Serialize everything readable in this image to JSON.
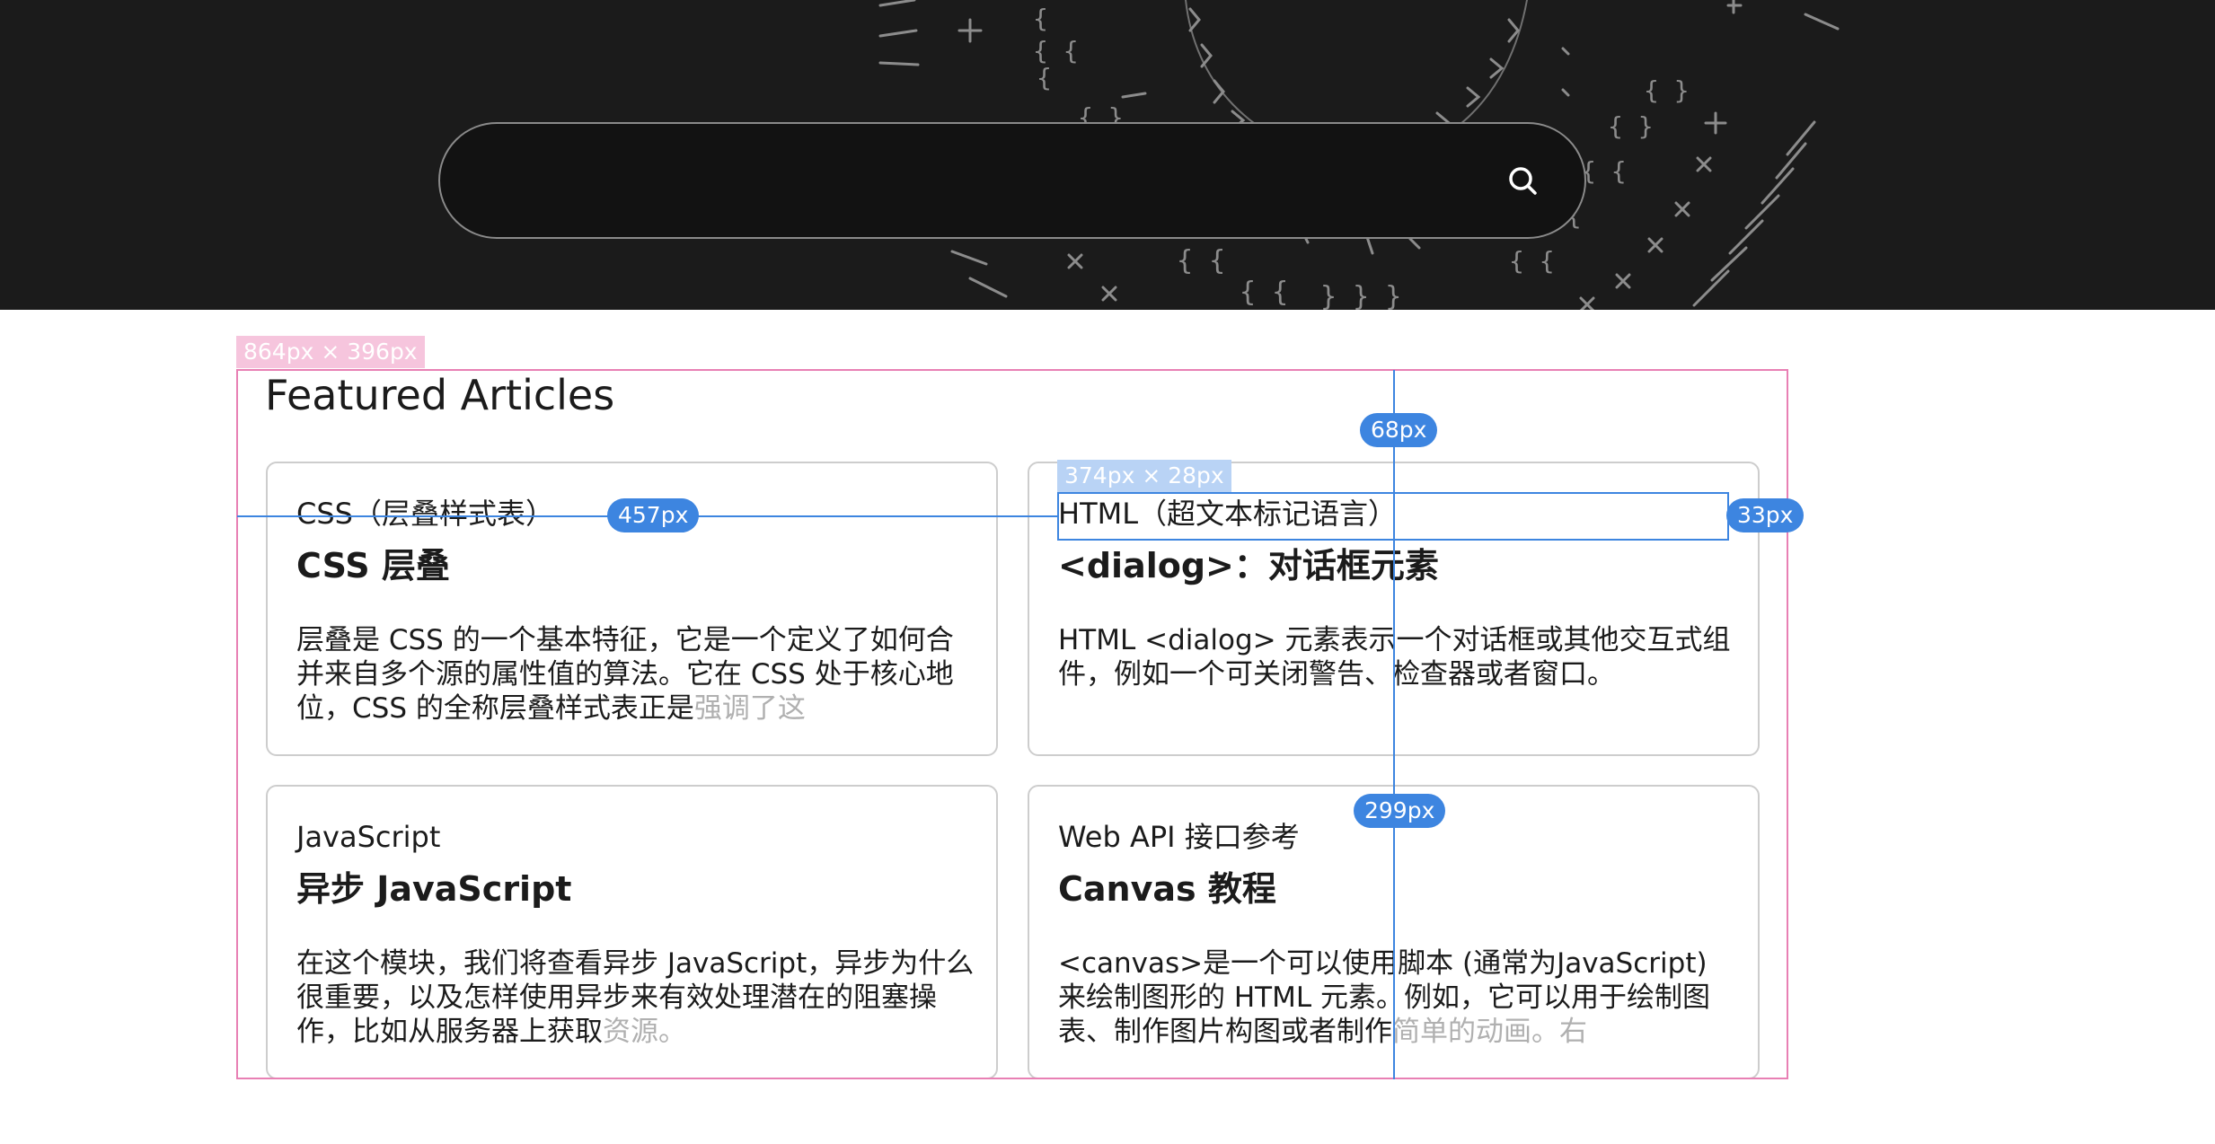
{
  "search": {
    "placeholder": "",
    "value": ""
  },
  "featured": {
    "heading": "Featured Articles",
    "cards": [
      {
        "category": "CSS（层叠样式表）",
        "title": "CSS 层叠",
        "description": "层叠是 CSS 的一个基本特征，它是一个定义了如何合并来自多个源的属性值的算法。它在 CSS 处于核心地位，CSS 的全称层叠样式表正是",
        "description_fade": "强调了这"
      },
      {
        "category": "HTML（超文本标记语言）",
        "title": "<dialog>：对话框元素",
        "description": "HTML <dialog> 元素表示一个对话框或其他交互式组件，例如一个可关闭警告、检查器或者窗口。",
        "description_fade": ""
      },
      {
        "category": "JavaScript",
        "title": "异步 JavaScript",
        "description": "在这个模块，我们将查看异步 JavaScript，异步为什么很重要，以及怎样使用异步来有效处理潜在的阻塞操作，比如从服务器上获取",
        "description_fade": "资源。"
      },
      {
        "category": "Web API 接口参考",
        "title": "Canvas 教程",
        "description": "<canvas>是一个可以使用脚本 (通常为JavaScript) 来绘制图形的 HTML 元素。例如，它可以用于绘制图表、制作图片构图或者制作",
        "description_fade": "简单的动画。右"
      }
    ]
  },
  "devtools": {
    "section_size_label": "864px × 396px",
    "element_size_label": "374px × 28px",
    "distance_left_label": "457px",
    "distance_top_label": "68px",
    "distance_right_label": "33px",
    "distance_bottom_label": "299px",
    "highlight_color": "#e880b4",
    "measure_color": "#3d85e0"
  },
  "colors": {
    "hero_background": "#1b1b1b",
    "text": "#1b1b1b",
    "card_border": "#cdcdcd"
  },
  "icons": {
    "search": "search-icon"
  }
}
